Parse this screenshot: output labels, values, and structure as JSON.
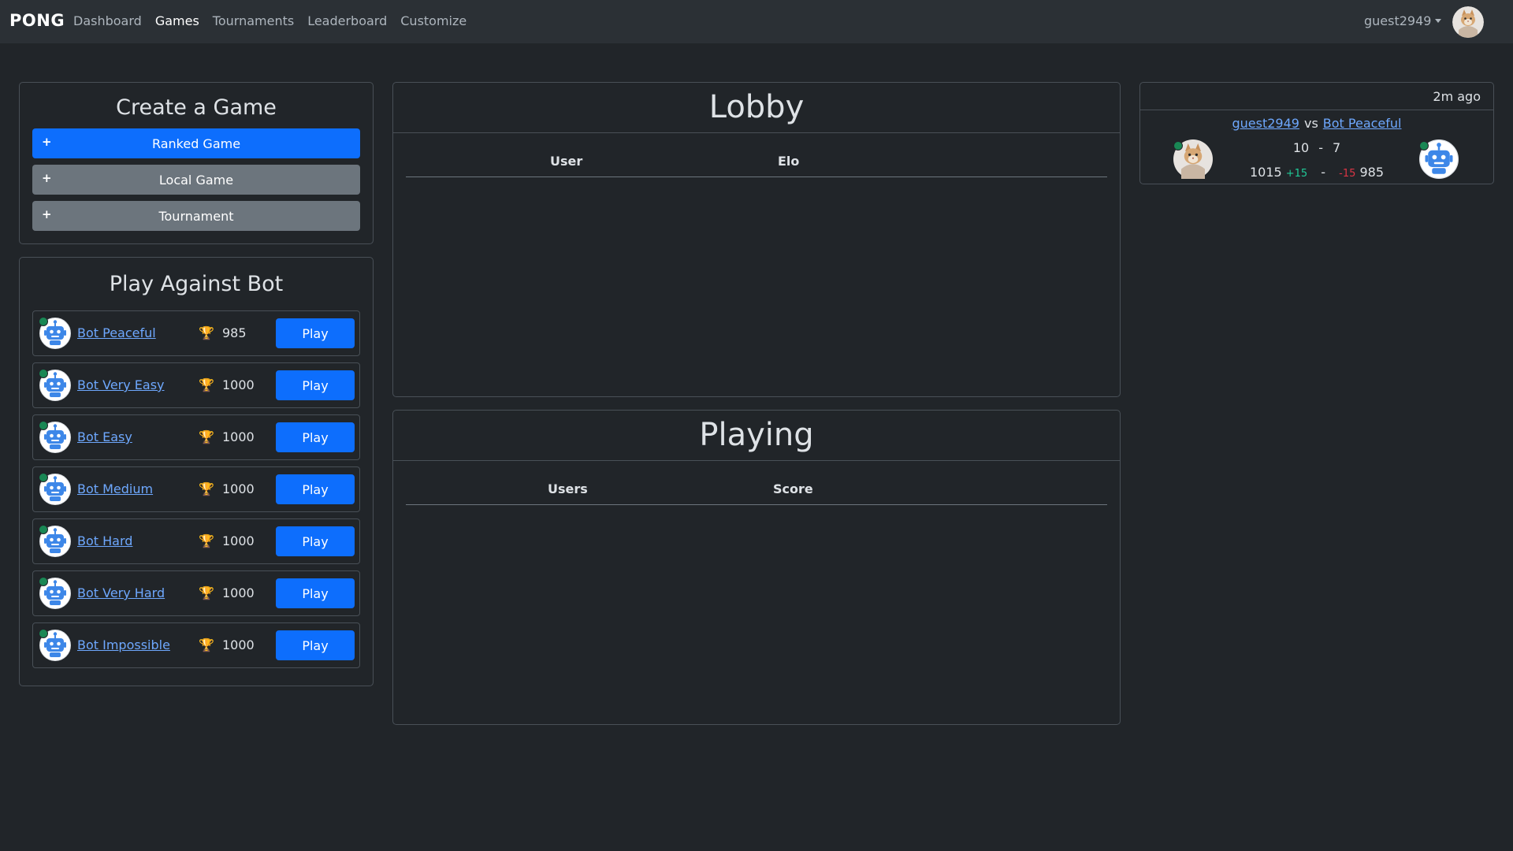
{
  "nav": {
    "brand": "PONG",
    "links": [
      "Dashboard",
      "Games",
      "Tournaments",
      "Leaderboard",
      "Customize"
    ],
    "active": "Games",
    "user": "guest2949"
  },
  "create": {
    "title": "Create a Game",
    "plus": "+",
    "ranked": "Ranked Game",
    "local": "Local Game",
    "tournament": "Tournament"
  },
  "bots": {
    "title": "Play Against Bot",
    "trophy_icon": "🏆",
    "play_label": "Play",
    "items": [
      {
        "name": "Bot Peaceful",
        "elo": "985"
      },
      {
        "name": "Bot Very Easy",
        "elo": "1000"
      },
      {
        "name": "Bot Easy",
        "elo": "1000"
      },
      {
        "name": "Bot Medium",
        "elo": "1000"
      },
      {
        "name": "Bot Hard",
        "elo": "1000"
      },
      {
        "name": "Bot Very Hard",
        "elo": "1000"
      },
      {
        "name": "Bot Impossible",
        "elo": "1000"
      }
    ]
  },
  "lobby": {
    "title": "Lobby",
    "columns": [
      "User",
      "Elo"
    ]
  },
  "playing": {
    "title": "Playing",
    "columns": [
      "Users",
      "Score"
    ]
  },
  "history": {
    "time": "2m ago",
    "player1": "guest2949",
    "vs": "vs",
    "player2": "Bot Peaceful",
    "score1": "10",
    "score2": "7",
    "elo1": "1015",
    "delta1": "+15",
    "delta2": "-15",
    "elo2": "985",
    "dash": "-"
  },
  "colors": {
    "background": "#212529",
    "navbar": "#2b3035",
    "primary": "#0d6efd",
    "secondary": "#6c757d",
    "online": "#198754",
    "link": "#6ea8fe"
  }
}
